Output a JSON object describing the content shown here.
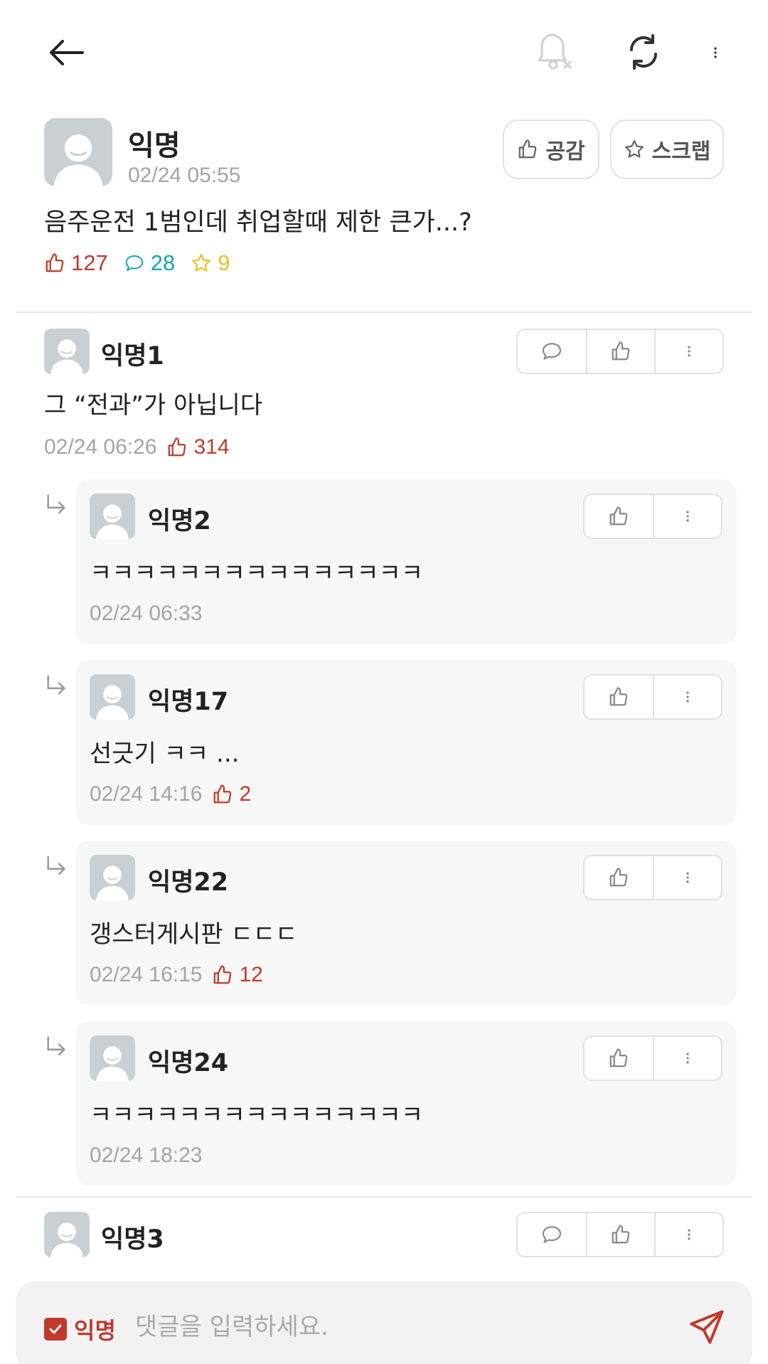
{
  "post": {
    "author": "익명",
    "time": "02/24 05:55",
    "title": "음주운전 1범인데 취업할때 제한 큰가...?",
    "like_button": "공감",
    "scrap_button": "스크랩",
    "stats": {
      "likes": "127",
      "comments": "28",
      "scraps": "9"
    }
  },
  "comments": [
    {
      "author": "익명1",
      "body": "그 “전과”가 아닙니다",
      "time": "02/24 06:26",
      "likes": "314",
      "replies": [
        {
          "author": "익명2",
          "body": "ㅋㅋㅋㅋㅋㅋㅋㅋㅋㅋㅋㅋㅋㅋㅋ",
          "time": "02/24 06:33",
          "likes": ""
        },
        {
          "author": "익명17",
          "body": "선긋기 ㅋㅋ ...",
          "time": "02/24 14:16",
          "likes": "2"
        },
        {
          "author": "익명22",
          "body": "갱스터게시판 ㄷㄷㄷ",
          "time": "02/24 16:15",
          "likes": "12"
        },
        {
          "author": "익명24",
          "body": "ㅋㅋㅋㅋㅋㅋㅋㅋㅋㅋㅋㅋㅋㅋㅋ",
          "time": "02/24 18:23",
          "likes": ""
        }
      ]
    },
    {
      "author": "익명3"
    }
  ],
  "input": {
    "anonymous_label": "익명",
    "anonymous_checked": true,
    "placeholder": "댓글을 입력하세요."
  },
  "colors": {
    "accent": "#c0392b",
    "comment_stat": "#17a2b8",
    "scrap_stat": "#e8c22a",
    "muted": "#a4a4a4"
  },
  "icons": {
    "topbar": [
      "back-arrow-icon",
      "notification-off-icon",
      "refresh-icon",
      "more-vertical-icon"
    ],
    "comment_actions": [
      "comment-icon",
      "thumbs-up-icon",
      "more-vertical-icon"
    ],
    "reply_actions": [
      "thumbs-up-icon",
      "more-vertical-icon"
    ],
    "input": [
      "checkbox-checked-icon",
      "send-icon"
    ]
  }
}
